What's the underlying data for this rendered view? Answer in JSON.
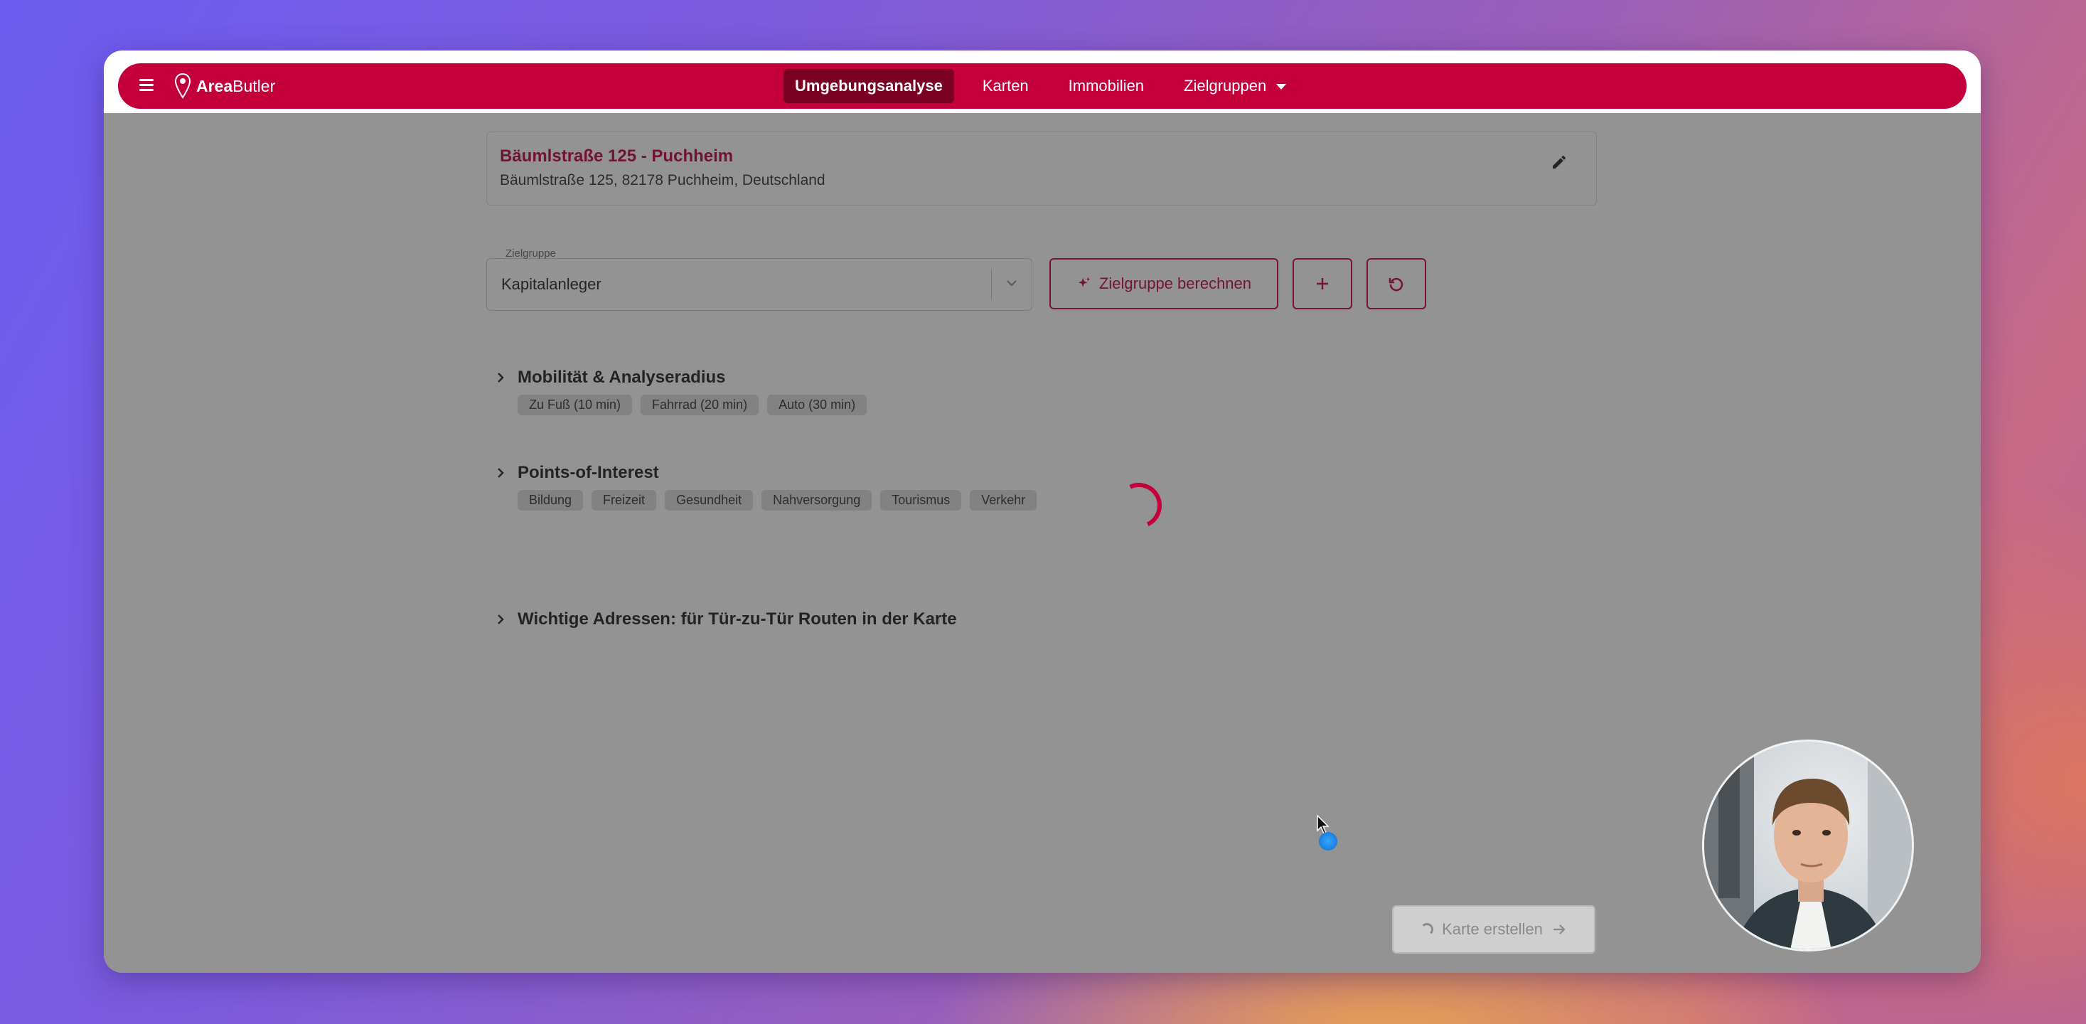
{
  "nav": {
    "brand_a": "Area",
    "brand_b": "Butler",
    "items": [
      {
        "label": "Umgebungsanalyse"
      },
      {
        "label": "Karten"
      },
      {
        "label": "Immobilien"
      },
      {
        "label": "Zielgruppen"
      }
    ]
  },
  "address": {
    "title": "Bäumlstraße 125 - Puchheim",
    "full": "Bäumlstraße 125, 82178 Puchheim, Deutschland"
  },
  "target_group": {
    "label": "Zielgruppe",
    "value": "Kapitalanleger",
    "calc_button": "Zielgruppe berechnen"
  },
  "sections": [
    {
      "title": "Mobilität & Analyseradius",
      "chips": [
        "Zu Fuß (10 min)",
        "Fahrrad (20 min)",
        "Auto (30 min)"
      ]
    },
    {
      "title": "Points-of-Interest",
      "chips": [
        "Bildung",
        "Freizeit",
        "Gesundheit",
        "Nahversorgung",
        "Tourismus",
        "Verkehr"
      ]
    },
    {
      "title": "Wichtige Adressen: für Tür-zu-Tür Routen in der Karte",
      "chips": []
    }
  ],
  "footer": {
    "create_map": "Karte erstellen"
  },
  "colors": {
    "accent": "#c4003c",
    "accent_dark": "#7a0024"
  }
}
